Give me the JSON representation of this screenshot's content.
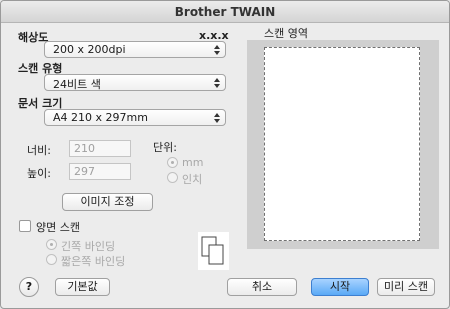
{
  "window": {
    "title": "Brother TWAIN"
  },
  "version": "x.x.x",
  "resolution": {
    "label": "해상도",
    "value": "200 x 200dpi"
  },
  "scan_type": {
    "label": "스캔 유형",
    "value": "24비트 색"
  },
  "doc_size": {
    "label": "문서 크기",
    "value": "A4  210 x 297mm"
  },
  "width": {
    "label": "너비:",
    "value": "210"
  },
  "height": {
    "label": "높이:",
    "value": "297"
  },
  "unit": {
    "label": "단위:",
    "options": [
      "mm",
      "인치"
    ],
    "selected": "mm"
  },
  "image_adjust_button": "이미지 조정",
  "duplex": {
    "label": "양면 스캔",
    "checked": false,
    "options": [
      "긴쪽 바인딩",
      "짧은쪽 바인딩"
    ]
  },
  "scan_area": {
    "label": "스캔 영역"
  },
  "buttons": {
    "help": "?",
    "default": "기본값",
    "cancel": "취소",
    "start": "시작",
    "prescan": "미리 스캔"
  }
}
